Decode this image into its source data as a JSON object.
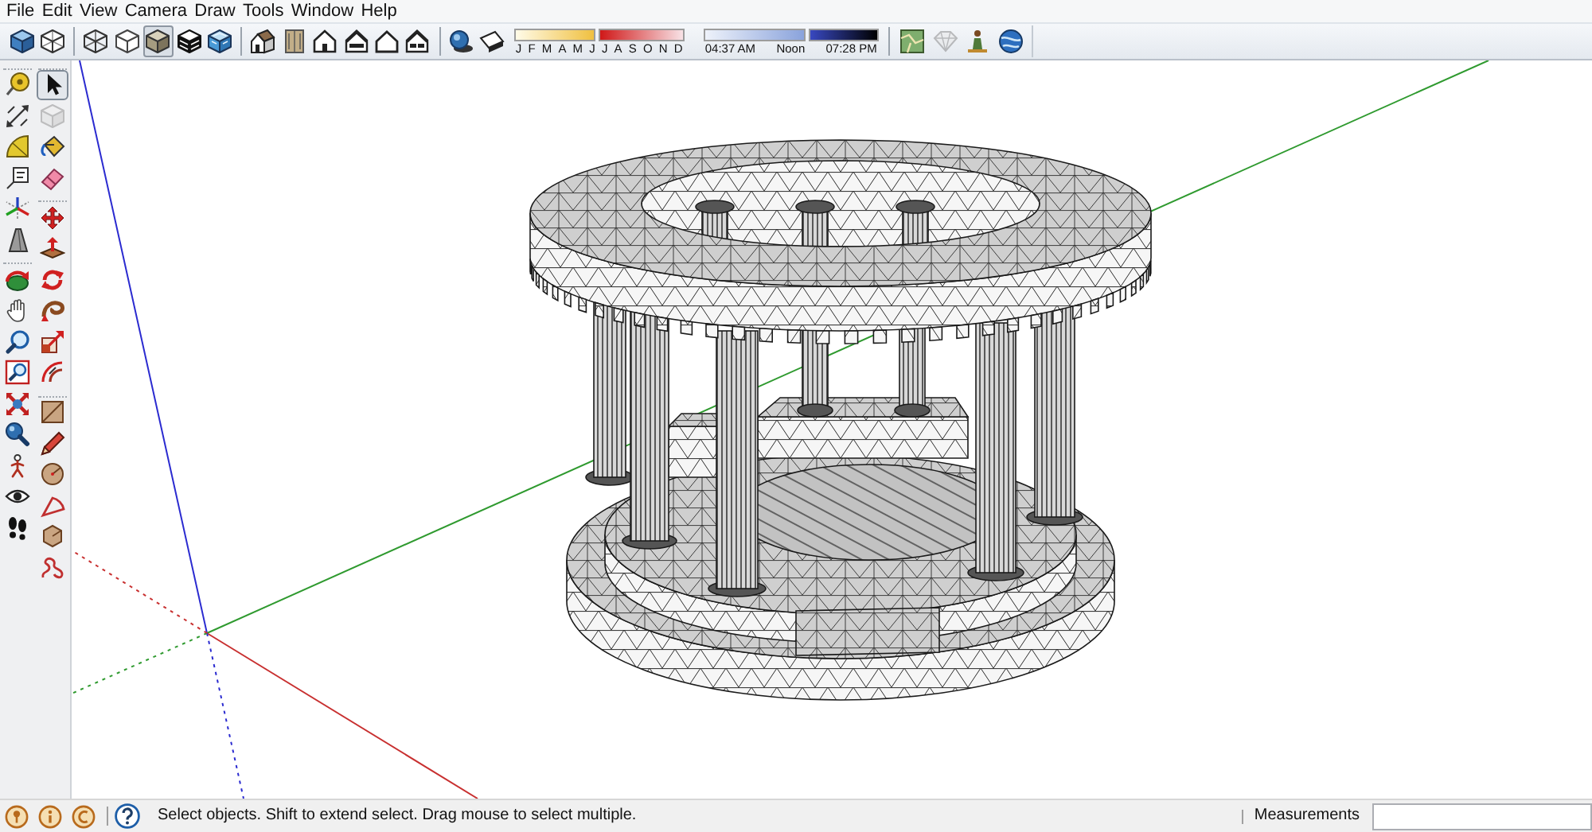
{
  "menu_bar": {
    "items": [
      "File",
      "Edit",
      "View",
      "Camera",
      "Draw",
      "Tools",
      "Window",
      "Help"
    ]
  },
  "toolbar": {
    "groups": [
      {
        "items": [
          {
            "kind": "cube"
          },
          {
            "kind": "wireframe"
          }
        ]
      },
      {
        "items": [
          {
            "kind": "xray",
            "selected": false
          },
          {
            "kind": "hidden",
            "selected": false
          },
          {
            "kind": "shaded",
            "selected": true
          },
          {
            "kind": "monochrome",
            "selected": false
          },
          {
            "kind": "textured",
            "selected": false
          }
        ]
      },
      {
        "items": [
          {
            "kind": "iso"
          },
          {
            "kind": "top"
          },
          {
            "kind": "front"
          },
          {
            "kind": "right"
          },
          {
            "kind": "back"
          },
          {
            "kind": "left"
          }
        ]
      },
      {
        "items": [
          {
            "kind": "shadowsettings"
          },
          {
            "kind": "shadows"
          }
        ]
      }
    ],
    "shadows": {
      "date_slider": {
        "level": 0.48,
        "months": [
          "J",
          "F",
          "M",
          "A",
          "M",
          "J",
          "J",
          "A",
          "S",
          "O",
          "N",
          "D"
        ]
      },
      "time_slider": {
        "level": 0.58,
        "labels": [
          "04:37 AM",
          "Noon",
          "07:28 PM"
        ]
      }
    },
    "extras": {
      "items": [
        {
          "kind": "map",
          "disabled": false
        },
        {
          "kind": "diamond",
          "disabled": true
        },
        {
          "kind": "figure",
          "disabled": false
        },
        {
          "kind": "globe",
          "disabled": false
        }
      ]
    }
  },
  "tool_palette": {
    "columns": [
      {
        "groups": [
          {
            "items": [
              {
                "kind": "tape",
                "selected": false,
                "disabled": false
              },
              {
                "kind": "dimension",
                "selected": false,
                "disabled": false
              },
              {
                "kind": "protractor",
                "selected": false,
                "disabled": false
              },
              {
                "kind": "text",
                "selected": false,
                "disabled": false
              },
              {
                "kind": "axes",
                "selected": false,
                "disabled": false
              },
              {
                "kind": "text3d",
                "selected": false,
                "disabled": false
              }
            ]
          },
          {
            "items": [
              {
                "kind": "orbit",
                "selected": false,
                "disabled": false
              },
              {
                "kind": "pan",
                "selected": false,
                "disabled": false
              },
              {
                "kind": "zoom",
                "selected": false,
                "disabled": false
              },
              {
                "kind": "zoomwindow",
                "selected": false,
                "disabled": false
              },
              {
                "kind": "extents",
                "selected": false,
                "disabled": false
              },
              {
                "kind": "position",
                "selected": false,
                "disabled": false
              },
              {
                "kind": "walk",
                "selected": false,
                "disabled": false
              },
              {
                "kind": "look",
                "selected": false,
                "disabled": false
              },
              {
                "kind": "footprints",
                "selected": false,
                "disabled": false
              }
            ]
          }
        ]
      },
      {
        "groups": [
          {
            "items": [
              {
                "kind": "select",
                "selected": true,
                "disabled": false
              },
              {
                "kind": "component",
                "selected": false,
                "disabled": true
              },
              {
                "kind": "paint",
                "selected": false,
                "disabled": false
              },
              {
                "kind": "eraser",
                "selected": false,
                "disabled": false
              }
            ]
          },
          {
            "items": [
              {
                "kind": "move",
                "selected": false,
                "disabled": false
              },
              {
                "kind": "pushpull",
                "selected": false,
                "disabled": false
              },
              {
                "kind": "rotate",
                "selected": false,
                "disabled": false
              },
              {
                "kind": "followme",
                "selected": false,
                "disabled": false
              },
              {
                "kind": "scale",
                "selected": false,
                "disabled": false
              },
              {
                "kind": "offset",
                "selected": false,
                "disabled": false
              }
            ]
          },
          {
            "items": [
              {
                "kind": "rectangle",
                "selected": false,
                "disabled": false
              },
              {
                "kind": "line",
                "selected": false,
                "disabled": false
              },
              {
                "kind": "circle",
                "selected": false,
                "disabled": false
              },
              {
                "kind": "arc",
                "selected": false,
                "disabled": false
              },
              {
                "kind": "polygon",
                "selected": false,
                "disabled": false
              },
              {
                "kind": "freehand",
                "selected": false,
                "disabled": false
              }
            ]
          }
        ]
      }
    ]
  },
  "status_bar": {
    "message": "Select objects. Shift to extend select. Drag mouse to select multiple.",
    "measurements": {
      "label": "Measurements"
    }
  }
}
